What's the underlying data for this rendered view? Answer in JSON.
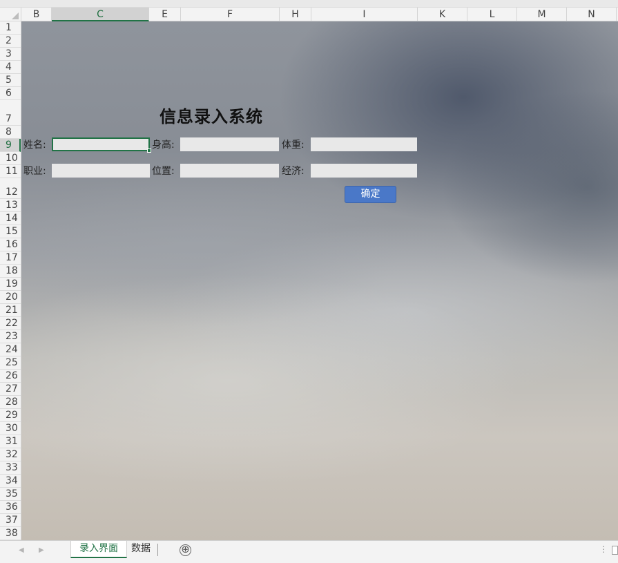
{
  "columns": [
    {
      "label": "B",
      "w": 44
    },
    {
      "label": "C",
      "w": 141,
      "selected": true
    },
    {
      "label": "E",
      "w": 46
    },
    {
      "label": "F",
      "w": 143
    },
    {
      "label": "H",
      "w": 46
    },
    {
      "label": "I",
      "w": 154
    },
    {
      "label": "K",
      "w": 72
    },
    {
      "label": "L",
      "w": 72
    },
    {
      "label": "M",
      "w": 72
    },
    {
      "label": "N",
      "w": 72
    }
  ],
  "rows": [
    "1",
    "2",
    "3",
    "4",
    "5",
    "6",
    "7",
    "8",
    "9",
    "10",
    "11",
    "12",
    "13",
    "14",
    "15",
    "16",
    "17",
    "18",
    "19",
    "20",
    "21",
    "22",
    "23",
    "24",
    "25",
    "26",
    "27",
    "28",
    "29",
    "30",
    "31",
    "32",
    "33",
    "34",
    "35",
    "36",
    "37",
    "38"
  ],
  "form": {
    "title": "信息录入系统",
    "name_label": "姓名:",
    "height_label": "身高:",
    "weight_label": "体重:",
    "job_label": "职业:",
    "position_label": "位置:",
    "economy_label": "经济:",
    "name_value": "",
    "height_value": "",
    "weight_value": "",
    "job_value": "",
    "position_value": "",
    "economy_value": "",
    "confirm_label": "确定"
  },
  "tabs": {
    "sheet1": "录入界面",
    "sheet2": "数据",
    "add_icon": "⊕",
    "prev_icon": "◀",
    "next_icon": "▶"
  },
  "colors": {
    "accent": "#217346",
    "button": "#4a78c8"
  }
}
